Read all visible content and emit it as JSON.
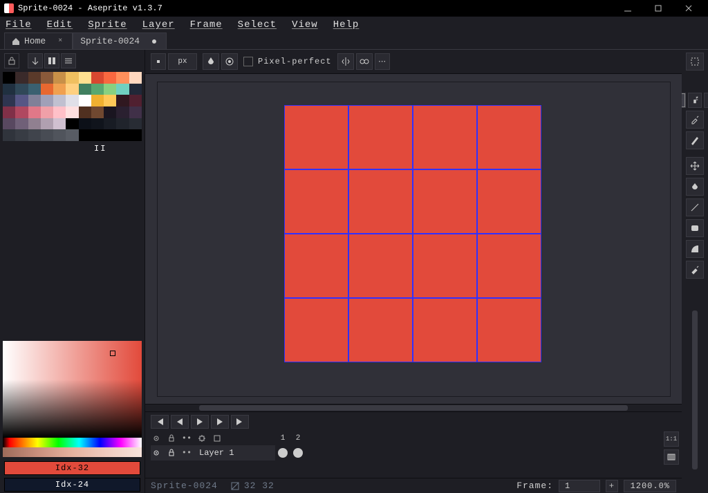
{
  "window": {
    "title": "Sprite-0024 - Aseprite v1.3.7"
  },
  "menu": [
    "File",
    "Edit",
    "Sprite",
    "Layer",
    "Frame",
    "Select",
    "View",
    "Help"
  ],
  "tabs": [
    {
      "label": "Home",
      "active": false,
      "close": true
    },
    {
      "label": "Sprite-0024",
      "active": true,
      "dirty": true
    }
  ],
  "context": {
    "brush_label": "px",
    "pixel_perfect_label": "Pixel-perfect",
    "pixel_perfect": false
  },
  "palette_colors": [
    "#000000",
    "#3a2a2a",
    "#5a3a2a",
    "#8a5a3a",
    "#c89048",
    "#f0c060",
    "#ffe090",
    "#d84830",
    "#f86840",
    "#ff905c",
    "#ffd8c0",
    "#203040",
    "#304858",
    "#3a6070",
    "#e86830",
    "#f0a050",
    "#ffd080",
    "#408060",
    "#58a870",
    "#88d080",
    "#70d0c0",
    "#202838",
    "#2e3550",
    "#565685",
    "#808098",
    "#a0a0b8",
    "#c0c0d0",
    "#e0e0e8",
    "#ffffff",
    "#f0b030",
    "#ffc858",
    "#301820",
    "#502030",
    "#803048",
    "#b04860",
    "#e07888",
    "#f0a0a8",
    "#ffc0c8",
    "#ffe0e0",
    "#503020",
    "#704830",
    "#1a1520",
    "#2a2030",
    "#403048",
    "#584860",
    "#706078",
    "#908090",
    "#b0a0b0",
    "#d0c0d0",
    "#000000",
    "#0c1018",
    "#10141c",
    "#181c24",
    "#20242c",
    "#282c34",
    "#30343c",
    "#383c44",
    "#40444c",
    "#484c54",
    "#50545c",
    "#585c64"
  ],
  "color_indices": {
    "fg": "Idx-32",
    "bg": "Idx-24"
  },
  "timeline": {
    "layer_name": "Layer 1",
    "frames": [
      "1",
      "2"
    ]
  },
  "status": {
    "filename": "Sprite-0024",
    "size": "32 32",
    "frame_label": "Frame:",
    "frame": "1",
    "zoom": "1200.0%"
  },
  "canvas": {
    "grid": 4,
    "fill": "#e24a3b",
    "grid_color": "#3030ff"
  }
}
